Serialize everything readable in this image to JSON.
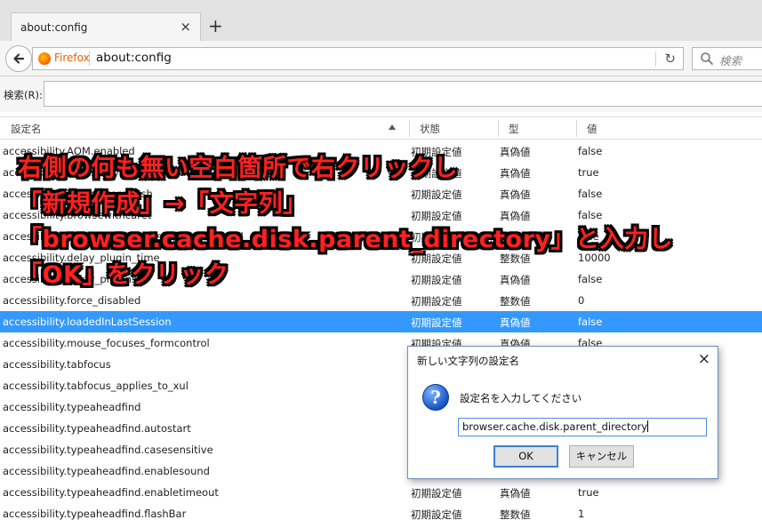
{
  "tab": {
    "title": "about:config",
    "close": "×",
    "new_tab": "+"
  },
  "navbar": {
    "identity_label": "Firefox",
    "url": "about:config",
    "reload": "↻",
    "search_placeholder": "検索"
  },
  "filter": {
    "label": "検索(R):",
    "value": ""
  },
  "columns": {
    "name": "設定名",
    "status": "状態",
    "type": "型",
    "value": "値"
  },
  "rows": [
    {
      "name": "accessibility.AOM.enabled",
      "status": "初期設定値",
      "type": "真偽値",
      "value": "false"
    },
    {
      "name": "accessibility.accesskeycausesactivation",
      "status": "初期設定値",
      "type": "真偽値",
      "value": "true"
    },
    {
      "name": "accessibility.blockautorefresh",
      "status": "初期設定値",
      "type": "真偽値",
      "value": "false"
    },
    {
      "name": "accessibility.browsewithcaret",
      "status": "初期設定値",
      "type": "真偽値",
      "value": "false"
    },
    {
      "name": "accessibility.browsewithcaret_shortcut.enabled",
      "status": "初期設定値",
      "type": "真偽値",
      "value": "true"
    },
    {
      "name": "accessibility.delay_plugin_time",
      "status": "初期設定値",
      "type": "整数値",
      "value": "10000"
    },
    {
      "name": "accessibility.delay_plugins",
      "status": "初期設定値",
      "type": "真偽値",
      "value": "false"
    },
    {
      "name": "accessibility.force_disabled",
      "status": "初期設定値",
      "type": "整数値",
      "value": "0"
    },
    {
      "name": "accessibility.loadedInLastSession",
      "status": "初期設定値",
      "type": "真偽値",
      "value": "false"
    },
    {
      "name": "accessibility.mouse_focuses_formcontrol",
      "status": "初期設定値",
      "type": "真偽値",
      "value": "false"
    },
    {
      "name": "accessibility.tabfocus",
      "status": "",
      "type": "",
      "value": ""
    },
    {
      "name": "accessibility.tabfocus_applies_to_xul",
      "status": "",
      "type": "",
      "value": ""
    },
    {
      "name": "accessibility.typeaheadfind",
      "status": "",
      "type": "",
      "value": ""
    },
    {
      "name": "accessibility.typeaheadfind.autostart",
      "status": "",
      "type": "",
      "value": ""
    },
    {
      "name": "accessibility.typeaheadfind.casesensitive",
      "status": "",
      "type": "",
      "value": ""
    },
    {
      "name": "accessibility.typeaheadfind.enablesound",
      "status": "",
      "type": "",
      "value": ""
    },
    {
      "name": "accessibility.typeaheadfind.enabletimeout",
      "status": "初期設定値",
      "type": "真偽値",
      "value": "true"
    },
    {
      "name": "accessibility.typeaheadfind.flashBar",
      "status": "初期設定値",
      "type": "整数値",
      "value": "1"
    }
  ],
  "selected_row": 8,
  "annotation": {
    "line1": "右側の何も無い空白箇所で右クリックし",
    "line2": "「新規作成」→「文字列」",
    "line3": "「browser.cache.disk.parent_directory」と入力し",
    "line4": "「OK」をクリック"
  },
  "dialog": {
    "title": "新しい文字列の設定名",
    "close": "×",
    "message": "設定名を入力してください",
    "input_value": "browser.cache.disk.parent_directory",
    "ok_label": "OK",
    "cancel_label": "キャンセル"
  },
  "colors": {
    "selection": "#3399ff",
    "annotation_text": "#ff2020",
    "firefox_label": "#e66000"
  }
}
